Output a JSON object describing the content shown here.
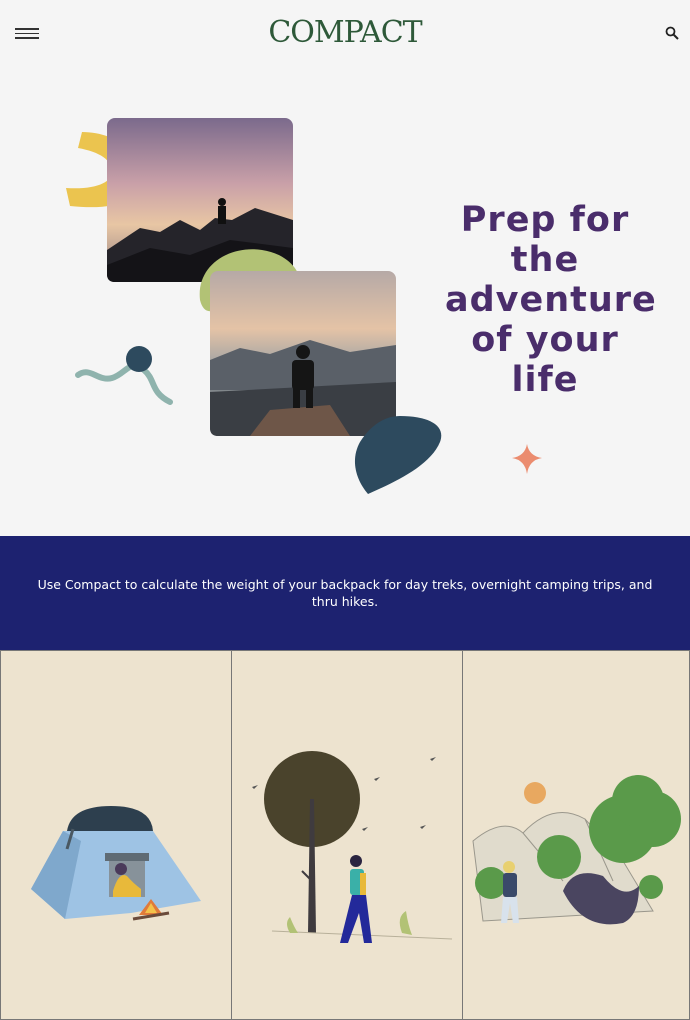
{
  "header": {
    "logo": "COMPACT",
    "menu_icon": "hamburger-menu-icon",
    "search_icon": "search-icon"
  },
  "hero": {
    "title_lines": [
      "Prep for",
      "the",
      "adventure",
      "of your",
      "life"
    ],
    "photos": [
      "mountain-sunset-photo",
      "hiker-on-cliff-photo"
    ]
  },
  "banner": {
    "text": "Use Compact to calculate the weight of your backpack for day treks, overnight camping trips, and thru hikes."
  },
  "cards": [
    {
      "illustration": "tent-camping-illustration"
    },
    {
      "illustration": "hiker-with-tree-illustration"
    },
    {
      "illustration": "mountains-with-trees-illustration"
    }
  ],
  "colors": {
    "brand": "#2e5939",
    "title": "#4a2d6b",
    "banner": "#1d2270",
    "card_bg": "#ede3cf",
    "page_bg": "#f5f5f5"
  }
}
